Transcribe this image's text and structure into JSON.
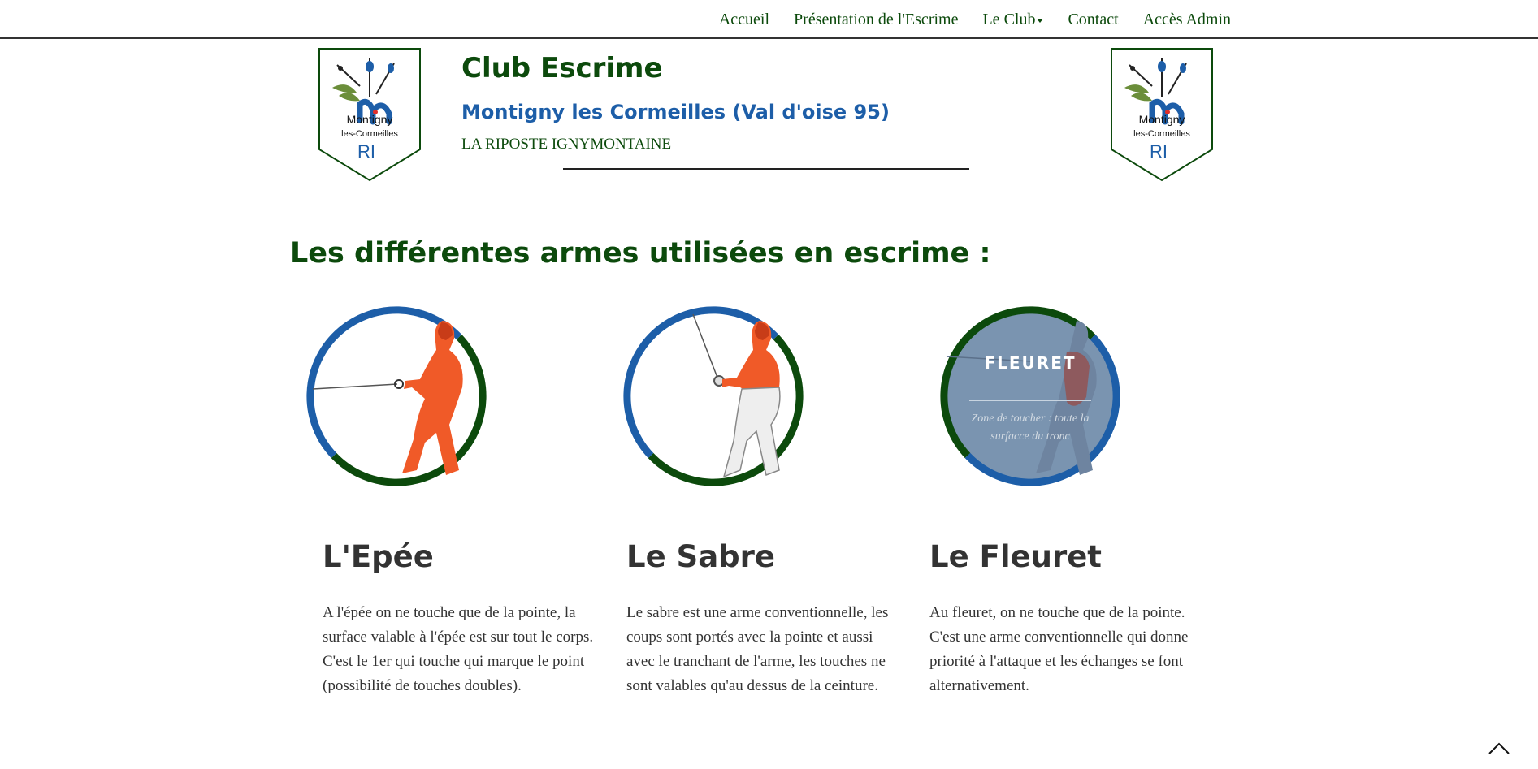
{
  "nav": {
    "items": [
      {
        "label": "Accueil",
        "dropdown": false
      },
      {
        "label": "Présentation de l'Escrime",
        "dropdown": false
      },
      {
        "label": "Le Club",
        "dropdown": true
      },
      {
        "label": "Contact",
        "dropdown": false
      },
      {
        "label": "Accès Admin",
        "dropdown": false
      }
    ]
  },
  "header": {
    "title": "Club Escrime",
    "subtitle": "Montigny les Cormeilles (Val d'oise 95)",
    "tagline": "LA RIPOSTE IGNYMONTAINE",
    "logo": {
      "line1": "Montigny",
      "line2": "les-Cormeilles",
      "initials": "RI"
    }
  },
  "section": {
    "heading": "Les différentes armes utilisées en escrime :"
  },
  "weapons": [
    {
      "title": "L'Epée",
      "text": "A l'épée on ne touche que de la pointe, la surface valable à l'épée est sur tout le corps. C'est le 1er qui touche qui marque le point (possibilité de touches doubles)."
    },
    {
      "title": "Le Sabre",
      "text": "Le sabre est une arme conventionnelle, les coups sont portés avec la pointe et aussi avec le tranchant de l'arme, les touches ne sont valables qu'au dessus de la ceinture."
    },
    {
      "title": "Le Fleuret",
      "text": "Au fleuret, on ne touche que de la pointe. C'est une arme conventionnelle qui donne priorité à l'attaque et les échanges se font alternativement.",
      "overlay_title": "FLEURET",
      "overlay_text": "Zone de toucher : toute la surfacce du tronc"
    }
  ],
  "colors": {
    "green": "#0c4a0c",
    "blue": "#1d5ea8",
    "orange": "#f05a28",
    "text": "#333333"
  },
  "icons": {
    "scroll_top": "chevron-up-icon"
  }
}
